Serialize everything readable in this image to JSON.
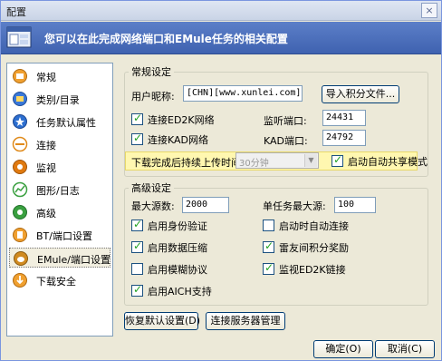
{
  "window": {
    "title": "配置",
    "close_glyph": "×"
  },
  "banner": {
    "text": "您可以在此完成网络端口和EMule任务的相关配置"
  },
  "sidebar": {
    "items": [
      {
        "label": "常规",
        "icon": "general-icon",
        "color": "#f0a030"
      },
      {
        "label": "类别/目录",
        "icon": "folder-icon",
        "color": "#3a78d8"
      },
      {
        "label": "任务默认属性",
        "icon": "task-properties-icon",
        "color": "#2d6fd0"
      },
      {
        "label": "连接",
        "icon": "connection-icon",
        "color": "#e08a1a"
      },
      {
        "label": "监视",
        "icon": "monitor-icon",
        "color": "#e07a10"
      },
      {
        "label": "图形/日志",
        "icon": "chart-log-icon",
        "color": "#3aa040"
      },
      {
        "label": "高级",
        "icon": "advanced-icon",
        "color": "#3aa040"
      },
      {
        "label": "BT/端口设置",
        "icon": "bt-port-icon",
        "color": "#f0a030"
      },
      {
        "label": "EMule/端口设置",
        "icon": "emule-port-icon",
        "color": "#d08a20"
      },
      {
        "label": "下载安全",
        "icon": "download-security-icon",
        "color": "#f0a030"
      }
    ],
    "selected_index": 8
  },
  "general_settings": {
    "legend": "常规设定",
    "nickname_label": "用户昵称:",
    "nickname_value": "[CHN][www.xunlei.com]",
    "import_button": "导入积分文件...",
    "connect_ed2k": {
      "label": "连接ED2K网络",
      "checked": true
    },
    "connect_kad": {
      "label": "连接KAD网络",
      "checked": true
    },
    "listen_port_label": "监听端口:",
    "listen_port_value": "24431",
    "kad_port_label": "KAD端口:",
    "kad_port_value": "24792",
    "upload_time_label": "下载完成后持续上传时间:",
    "upload_time_value": "30分钟",
    "auto_share": {
      "label": "启动自动共享模式",
      "checked": true
    }
  },
  "advanced_settings": {
    "legend": "高级设定",
    "max_sources_label": "最大源数:",
    "max_sources_value": "2000",
    "per_task_max_label": "单任务最大源:",
    "per_task_max_value": "100",
    "options": [
      {
        "label": "启用身份验证",
        "checked": true
      },
      {
        "label": "启动时自动连接",
        "checked": false
      },
      {
        "label": "启用数据压缩",
        "checked": true
      },
      {
        "label": "雷友间积分奖励",
        "checked": true
      },
      {
        "label": "启用模糊协议",
        "checked": false
      },
      {
        "label": "监视ED2K链接",
        "checked": true
      },
      {
        "label": "启用AICH支持",
        "checked": true
      }
    ]
  },
  "buttons": {
    "restore_default": "恢复默认设置(D)",
    "server_manage": "连接服务器管理",
    "ok": "确定(O)",
    "cancel": "取消(C)"
  }
}
